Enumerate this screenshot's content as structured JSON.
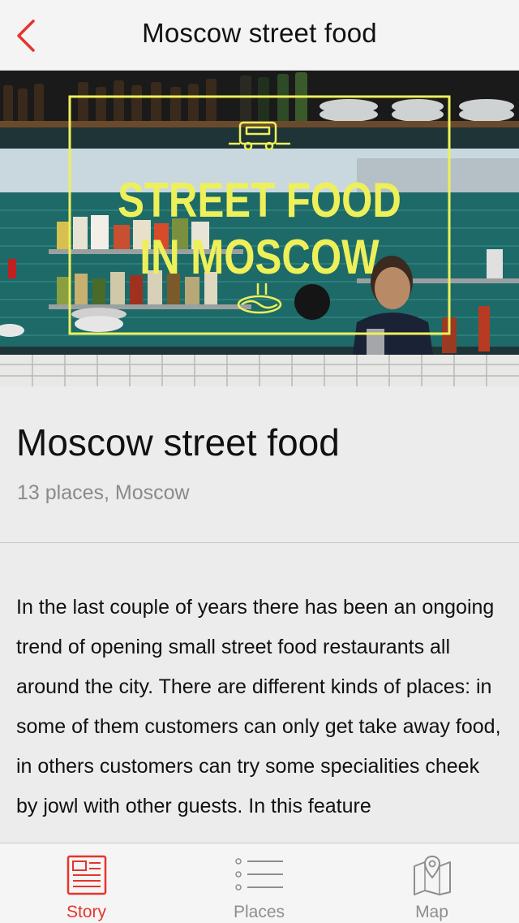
{
  "theme": {
    "accent": "#e5352b",
    "inactive": "#8e8e8e"
  },
  "navbar": {
    "title": "Moscow street food",
    "back_icon": "chevron-left-icon"
  },
  "hero": {
    "overlay_line1": "STREET FOOD",
    "overlay_line2": "IN MOSCOW",
    "overlay_color": "#eef05a"
  },
  "article": {
    "title": "Moscow street food",
    "meta": "13 places, Moscow",
    "body": "In the last couple of years there has been an ongoing trend of opening small street food restaurants all around the city. There are different kinds of places: in some of them customers can only get  take away food, in others customers can try some specialities cheek by jowl with other guests. In this feature"
  },
  "tabs": [
    {
      "label": "Story",
      "icon": "story-icon",
      "active": true
    },
    {
      "label": "Places",
      "icon": "list-icon",
      "active": false
    },
    {
      "label": "Map",
      "icon": "map-icon",
      "active": false
    }
  ]
}
